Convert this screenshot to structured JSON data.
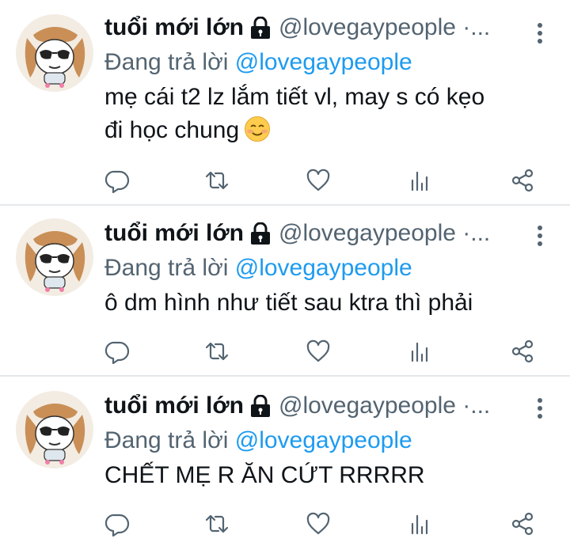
{
  "tweets": [
    {
      "display_name": "tuổi mới lớn",
      "handle": "@lovegaypeople ·...",
      "reply_prefix": "Đang trả lời",
      "reply_to": "@lovegaypeople",
      "text_lines": [
        "mẹ cái t2 lz lắm tiết vl, may s có kẹo",
        "đi học chung"
      ],
      "emoji": "smiling-face-emoji"
    },
    {
      "display_name": "tuổi mới lớn",
      "handle": "@lovegaypeople ·...",
      "reply_prefix": "Đang trả lời",
      "reply_to": "@lovegaypeople",
      "text_lines": [
        "ô dm hình như tiết sau ktra thì phải"
      ]
    },
    {
      "display_name": "tuổi mới lớn",
      "handle": "@lovegaypeople ·...",
      "reply_prefix": "Đang trả lời",
      "reply_to": "@lovegaypeople",
      "text_lines": [
        "CHẾT MẸ R ĂN CỨT RRRRR"
      ]
    }
  ],
  "icons": {
    "reply": "reply-icon",
    "retweet": "retweet-icon",
    "like": "like-icon",
    "views": "views-icon",
    "share": "share-icon",
    "more": "more-icon",
    "lock": "lock-icon"
  },
  "colors": {
    "text": "#0f1419",
    "secondary": "#536471",
    "accent": "#1d9bf0",
    "divider": "#e5e8eb"
  }
}
